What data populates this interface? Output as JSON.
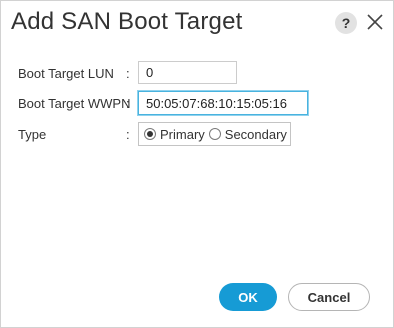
{
  "dialog": {
    "title": "Add SAN Boot Target",
    "help_label": "?"
  },
  "form": {
    "lun": {
      "label": "Boot Target LUN",
      "colon": ":",
      "value": "0"
    },
    "wwpn": {
      "label": "Boot Target WWPN",
      "colon": ":",
      "value": "50:05:07:68:10:15:05:16"
    },
    "type": {
      "label": "Type",
      "colon": ":",
      "options": [
        {
          "label": "Primary",
          "selected": true
        },
        {
          "label": "Secondary",
          "selected": false
        }
      ]
    }
  },
  "actions": {
    "ok_label": "OK",
    "cancel_label": "Cancel"
  },
  "colors": {
    "primary_button": "#169bd5",
    "focus_border": "#49b3df",
    "text": "#333333"
  },
  "icons": {
    "help": "help-icon",
    "close": "close-icon"
  }
}
